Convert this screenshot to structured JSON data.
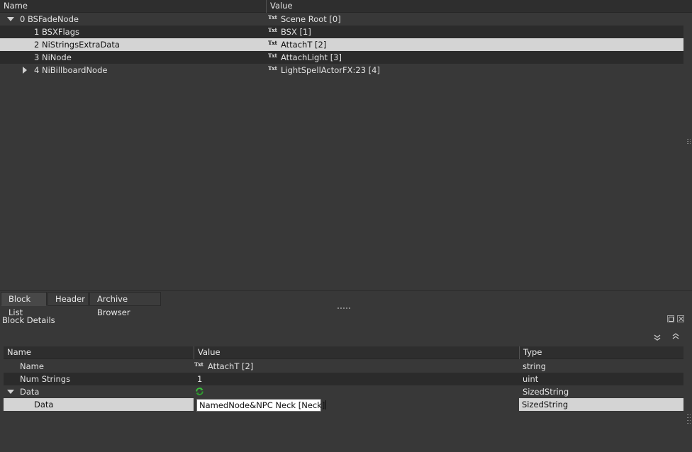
{
  "block_list": {
    "columns": {
      "name": "Name",
      "value": "Value"
    },
    "rows": [
      {
        "index_name": "0 BSFadeNode",
        "value": "Scene Root [0]",
        "expanded": true
      },
      {
        "index_name": "1 BSXFlags",
        "value": "BSX [1]"
      },
      {
        "index_name": "2 NiStringsExtraData",
        "value": "AttachT [2]",
        "selected": true
      },
      {
        "index_name": "3 NiNode",
        "value": "AttachLight [3]"
      },
      {
        "index_name": "4 NiBillboardNode",
        "value": "LightSpellActorFX:23 [4]",
        "collapsed": true
      }
    ],
    "value_icon": "Txt"
  },
  "tabs": [
    {
      "label": "Block List",
      "active": true
    },
    {
      "label": "Header"
    },
    {
      "label": "Archive Browser"
    }
  ],
  "block_details": {
    "title": "Block Details",
    "columns": {
      "name": "Name",
      "value": "Value",
      "type": "Type"
    },
    "rows": [
      {
        "name": "Name",
        "value": "AttachT [2]",
        "type": "string"
      },
      {
        "name": "Num Strings",
        "value": "1",
        "type": "uint"
      },
      {
        "name": "Data",
        "value": "",
        "type": "SizedString",
        "expanded": true
      },
      {
        "name": "Data",
        "value": "NamedNode&NPC Neck [Neck]",
        "type": "SizedString",
        "editing": true
      }
    ],
    "value_icon": "Txt"
  },
  "colors": {
    "background": "#383838",
    "row_alt": "#2b2b2b",
    "selection": "#d4d4d4",
    "header": "#2e2e2e",
    "refresh_icon": "#3bbf3b"
  }
}
